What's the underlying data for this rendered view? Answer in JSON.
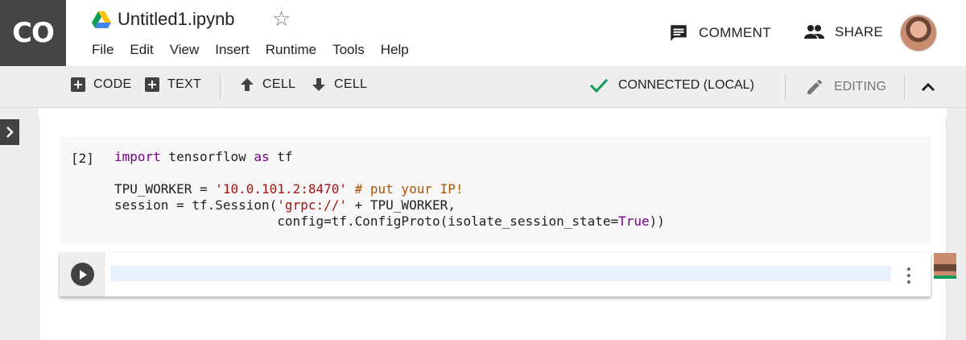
{
  "app": {
    "logo_text": "CO",
    "title": "Untitled1.ipynb"
  },
  "menu": [
    "File",
    "Edit",
    "View",
    "Insert",
    "Runtime",
    "Tools",
    "Help"
  ],
  "header": {
    "comment_label": "COMMENT",
    "share_label": "SHARE"
  },
  "toolbar": {
    "add_code_label": "CODE",
    "add_text_label": "TEXT",
    "cell_up_label": "CELL",
    "cell_down_label": "CELL",
    "status_label": "CONNECTED (LOCAL)",
    "mode_label": "EDITING"
  },
  "cell": {
    "execution_count": "[2]",
    "code": {
      "l1_kw1": "import",
      "l1_mid": " tensorflow ",
      "l1_kw2": "as",
      "l1_end": " tf",
      "l3_a": "TPU_WORKER = ",
      "l3_str": "'10.0.101.2:8470'",
      "l3_cm": " # put your IP!",
      "l4_a": "session = tf.Session(",
      "l4_str": "'grpc://'",
      "l4_b": " + TPU_WORKER,",
      "l5_a": "                     config=tf.ConfigProto(isolate_session_state=",
      "l5_bool": "True",
      "l5_b": "))"
    }
  },
  "icons": {
    "drive": "google-drive-icon",
    "star": "star-outline-icon",
    "comment": "comment-icon",
    "share": "people-icon",
    "add": "plus-box-icon",
    "up": "arrow-up-icon",
    "down": "arrow-down-icon",
    "check": "check-icon",
    "pencil": "pencil-icon",
    "collapse": "chevron-up-icon",
    "play": "play-icon",
    "more": "more-vert-icon",
    "expand": "chevron-right-icon"
  },
  "colors": {
    "logo_bg": "#444444",
    "connected_check": "#0f9d58",
    "toolbar_bg": "#eeeeee",
    "keyword": "#770088",
    "string": "#a11",
    "comment": "#aa5500"
  }
}
